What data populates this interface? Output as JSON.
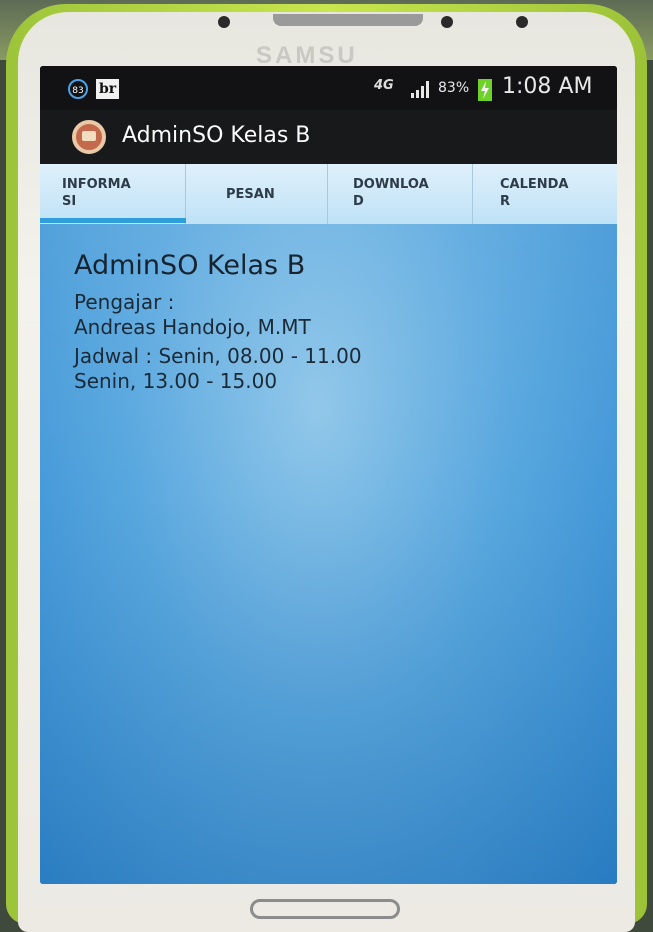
{
  "device": {
    "brand": "SAMSU"
  },
  "status_bar": {
    "notification_count": "83",
    "notification_app": "br",
    "network": "4G",
    "battery_percent": "83%",
    "time": "1:08 AM",
    "colors": {
      "battery": "#6fd22b",
      "notif_ring": "#4aa3e8"
    }
  },
  "app": {
    "title": "AdminSO Kelas B",
    "icon": "book-icon"
  },
  "tabs": [
    {
      "label_l1": "INFORMA",
      "label_l2": "SI",
      "selected": true
    },
    {
      "label_l1": "PESAN",
      "label_l2": ""
    },
    {
      "label_l1": "DOWNLOA",
      "label_l2": "D"
    },
    {
      "label_l1": "CALENDA",
      "label_l2": "R"
    }
  ],
  "content": {
    "title": "AdminSO Kelas B",
    "pengajar_label": "Pengajar :",
    "pengajar_name": "Andreas Handojo, M.MT",
    "jadwal_1": "Jadwal : Senin, 08.00 - 11.00",
    "jadwal_2": "Senin, 13.00 - 15.00"
  },
  "colors": {
    "accent": "#2f9edb",
    "tab_bg": "#cfe9f9",
    "content_bg": "#4d9fdb"
  }
}
